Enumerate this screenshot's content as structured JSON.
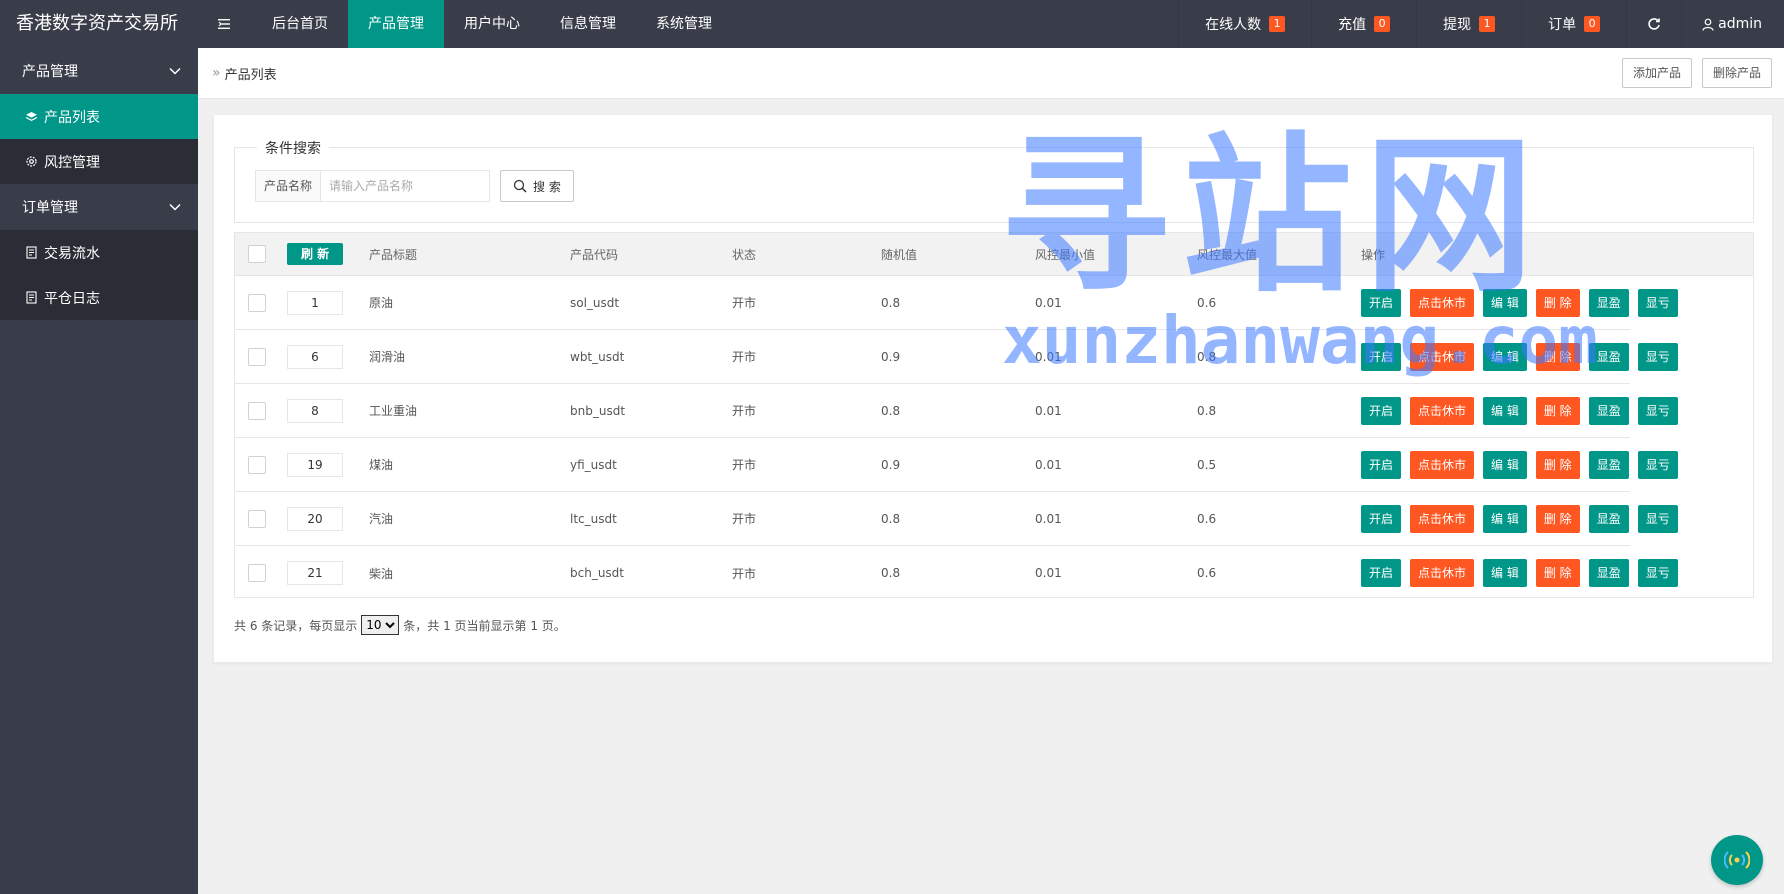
{
  "brand": "香港数字资产交易所",
  "topnav": [
    {
      "label": "后台首页",
      "active": false
    },
    {
      "label": "产品管理",
      "active": true
    },
    {
      "label": "用户中心",
      "active": false
    },
    {
      "label": "信息管理",
      "active": false
    },
    {
      "label": "系统管理",
      "active": false
    }
  ],
  "topright": {
    "online": {
      "label": "在线人数",
      "count": "1"
    },
    "recharge": {
      "label": "充值",
      "count": "0"
    },
    "withdraw": {
      "label": "提现",
      "count": "1"
    },
    "orders": {
      "label": "订单",
      "count": "0"
    },
    "user": "admin"
  },
  "sidebar": {
    "group1": "产品管理",
    "item_list": "产品列表",
    "item_risk": "风控管理",
    "group2": "订单管理",
    "item_trade": "交易流水",
    "item_close": "平仓日志"
  },
  "breadcrumb": {
    "current": "产品列表",
    "add": "添加产品",
    "delete": "删除产品"
  },
  "search": {
    "legend": "条件搜索",
    "label": "产品名称",
    "placeholder": "请输入产品名称",
    "button": "搜 索"
  },
  "table": {
    "refresh": "刷 新",
    "headers": {
      "title": "产品标题",
      "code": "产品代码",
      "status": "状态",
      "random": "随机值",
      "risk_min": "风控最小值",
      "risk_max": "风控最大值",
      "ops": "操作"
    },
    "ops": {
      "open": "开启",
      "close": "点击休市",
      "edit": "编 辑",
      "del": "删 除",
      "win": "显盈",
      "lose": "显亏"
    },
    "rows": [
      {
        "sort": "1",
        "title": "原油",
        "code": "sol_usdt",
        "status": "开市",
        "random": "0.8",
        "min": "0.01",
        "max": "0.6"
      },
      {
        "sort": "6",
        "title": "润滑油",
        "code": "wbt_usdt",
        "status": "开市",
        "random": "0.9",
        "min": "0.01",
        "max": "0.8"
      },
      {
        "sort": "8",
        "title": "工业重油",
        "code": "bnb_usdt",
        "status": "开市",
        "random": "0.8",
        "min": "0.01",
        "max": "0.8"
      },
      {
        "sort": "19",
        "title": "煤油",
        "code": "yfi_usdt",
        "status": "开市",
        "random": "0.9",
        "min": "0.01",
        "max": "0.5"
      },
      {
        "sort": "20",
        "title": "汽油",
        "code": "ltc_usdt",
        "status": "开市",
        "random": "0.8",
        "min": "0.01",
        "max": "0.6"
      },
      {
        "sort": "21",
        "title": "柴油",
        "code": "bch_usdt",
        "status": "开市",
        "random": "0.8",
        "min": "0.01",
        "max": "0.6"
      }
    ]
  },
  "pager": {
    "prefix": "共 6 条记录，每页显示",
    "page_size": "10",
    "suffix": "条，共 1 页当前显示第 1 页。"
  },
  "watermark": {
    "cn": "寻站网",
    "en": "xunzhanwang.com"
  },
  "colors": {
    "dark": "#393d49",
    "darker": "#2a2d36",
    "green": "#009688",
    "orange": "#ff5722"
  }
}
